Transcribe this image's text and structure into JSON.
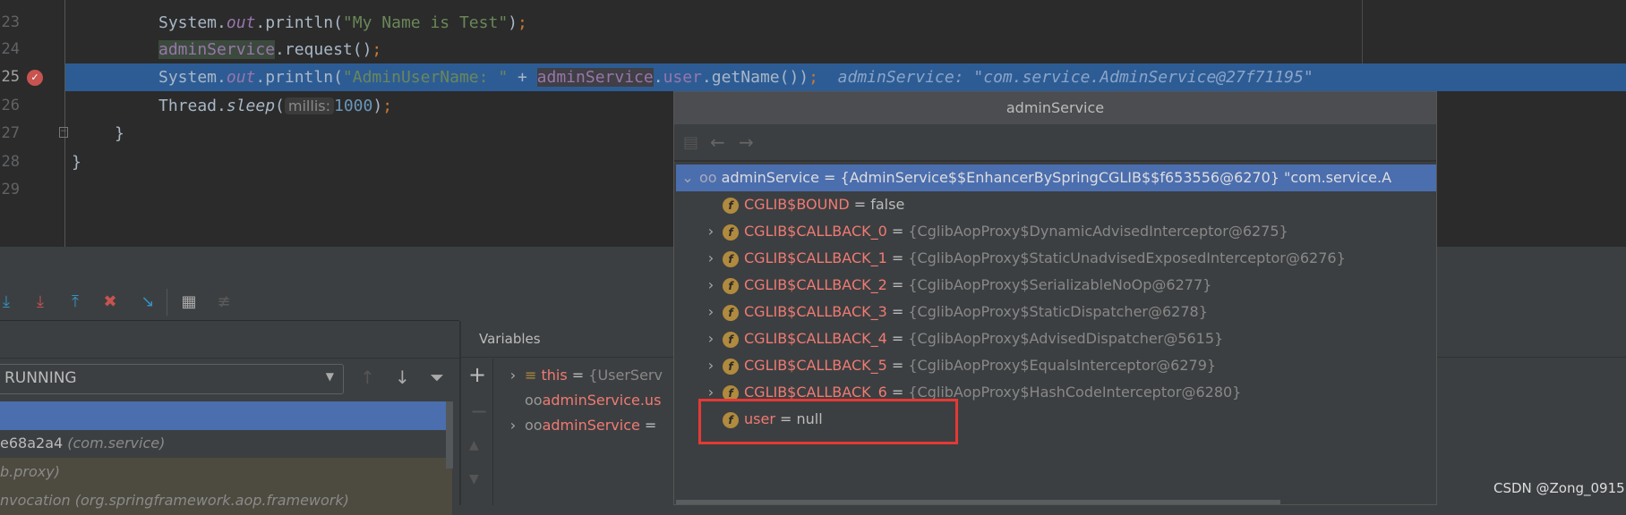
{
  "editor": {
    "line_numbers": [
      "23",
      "24",
      "25",
      "26",
      "27",
      "28",
      "29"
    ],
    "lines": {
      "l23": {
        "a": "System.",
        "b": "out",
        "c": ".println(",
        "d": "\"My Name is Test\"",
        "e": ")",
        "f": ";"
      },
      "l24": {
        "a": "adminService",
        "b": ".request()",
        "c": ";"
      },
      "l25": {
        "a": "System.",
        "b": "out",
        "c": ".println(",
        "d": "\"AdminUserName: \"",
        "e": " + ",
        "f": "adminService",
        "g": ".",
        "h": "user",
        "i": ".getName())",
        "j": ";",
        "inline": "adminService: \"com.service.AdminService@27f71195\""
      },
      "l26": {
        "a": "Thread.",
        "b": "sleep",
        "c": "(",
        "hint": "millis:",
        "d": "1000",
        "e": ")",
        "f": ";"
      },
      "l27": "}",
      "l28": "}"
    }
  },
  "debug_toolbar": {
    "icons": [
      "step-over-icon",
      "step-into-icon",
      "force-step-into-icon",
      "step-out-icon",
      "drop-frame-icon",
      "run-to-cursor-icon",
      "evaluate-expression-icon",
      "trace-icon"
    ]
  },
  "frames": {
    "thread_select": "RUNNING",
    "rows": [
      {
        "a": "",
        "b": ""
      },
      {
        "a": "e68a2a4 ",
        "b": "(com.service)"
      },
      {
        "a": "",
        "b": "b.proxy)"
      },
      {
        "a": "nvocation ",
        "b": "(org.springframework.aop.framework)"
      }
    ]
  },
  "variables": {
    "header": "Variables",
    "rows": [
      {
        "name": "this",
        "sep": " = ",
        "value": "{UserServ"
      },
      {
        "name": "adminService.us",
        "sep": "",
        "value": ""
      },
      {
        "name": "adminService",
        "sep": " = ",
        "value": ""
      }
    ]
  },
  "popup": {
    "title": "adminService",
    "root": {
      "name": "adminService",
      "sep": " = ",
      "value": "{AdminService$$EnhancerBySpringCGLIB$$f653556@6270} \"com.service.A"
    },
    "fields": [
      {
        "name": "CGLIB$BOUND",
        "value": "false",
        "expandable": false
      },
      {
        "name": "CGLIB$CALLBACK_0",
        "value": "{CglibAopProxy$DynamicAdvisedInterceptor@6275}",
        "expandable": true
      },
      {
        "name": "CGLIB$CALLBACK_1",
        "value": "{CglibAopProxy$StaticUnadvisedExposedInterceptor@6276}",
        "expandable": true
      },
      {
        "name": "CGLIB$CALLBACK_2",
        "value": "{CglibAopProxy$SerializableNoOp@6277}",
        "expandable": true
      },
      {
        "name": "CGLIB$CALLBACK_3",
        "value": "{CglibAopProxy$StaticDispatcher@6278}",
        "expandable": true
      },
      {
        "name": "CGLIB$CALLBACK_4",
        "value": "{CglibAopProxy$AdvisedDispatcher@5615}",
        "expandable": true
      },
      {
        "name": "CGLIB$CALLBACK_5",
        "value": "{CglibAopProxy$EqualsInterceptor@6279}",
        "expandable": true
      },
      {
        "name": "CGLIB$CALLBACK_6",
        "value": "{CglibAopProxy$HashCodeInterceptor@6280}",
        "expandable": true
      },
      {
        "name": "user",
        "value": "null",
        "expandable": false
      }
    ],
    "eq": " = "
  },
  "watermark": "CSDN @Zong_0915",
  "colors": {
    "selection": "#4b6eaf",
    "current_line": "#2d5c95",
    "highlight_box": "#e53935",
    "field_icon": "#b08a3e"
  }
}
